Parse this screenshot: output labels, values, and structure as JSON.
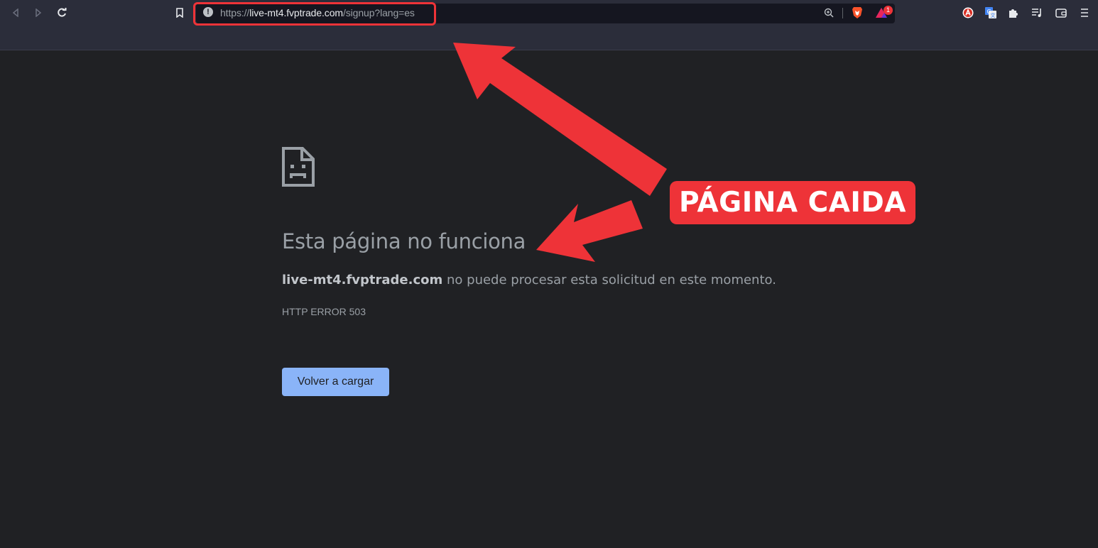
{
  "browser": {
    "url_scheme": "https://",
    "url_host": "live-mt4.fvptrade.com",
    "url_path": "/signup?lang=es",
    "notification_badge": "1"
  },
  "error_page": {
    "title": "Esta página no funciona",
    "host": "live-mt4.fvptrade.com",
    "message": " no puede procesar esta solicitud en este momento.",
    "error_code": "HTTP ERROR 503",
    "reload_label": "Volver a cargar"
  },
  "annotation": {
    "label": "PÁGINA CAIDA",
    "color": "#ee3338"
  },
  "colors": {
    "page_bg": "#202124",
    "toolbar_bg": "#2b2d3a",
    "button_bg": "#8ab4f8",
    "text_muted": "#9aa0a6"
  },
  "icons": {
    "back": "back-icon",
    "forward": "forward-icon",
    "reload": "reload-icon",
    "bookmark": "bookmark-icon",
    "site_info": "info-icon",
    "zoom": "zoom-icon",
    "brave_shield": "brave-shield-icon",
    "brave_rewards": "brave-rewards-icon",
    "extensions": [
      "adblock-icon",
      "translate-icon",
      "puzzle-icon",
      "playlist-icon",
      "wallet-icon",
      "menu-icon"
    ],
    "error": "sad-page-icon"
  }
}
